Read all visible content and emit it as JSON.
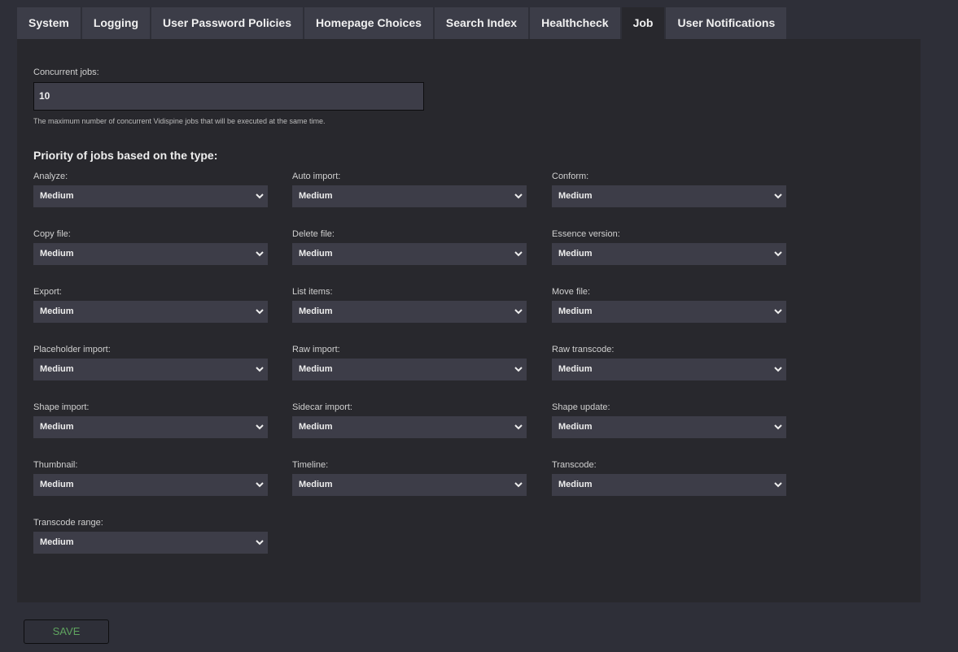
{
  "tabs": [
    "System",
    "Logging",
    "User Password Policies",
    "Homepage Choices",
    "Search Index",
    "Healthcheck",
    "Job",
    "User Notifications"
  ],
  "active_tab": "Job",
  "concurrent": {
    "label": "Concurrent jobs:",
    "value": "10",
    "help": "The maximum number of concurrent Vidispine jobs that will be executed at the same time."
  },
  "priority_heading": "Priority of jobs based on the type:",
  "fields": [
    {
      "label": "Analyze:",
      "value": "Medium"
    },
    {
      "label": "Auto import:",
      "value": "Medium"
    },
    {
      "label": "Conform:",
      "value": "Medium"
    },
    {
      "label": "Copy file:",
      "value": "Medium"
    },
    {
      "label": "Delete file:",
      "value": "Medium"
    },
    {
      "label": "Essence version:",
      "value": "Medium"
    },
    {
      "label": "Export:",
      "value": "Medium"
    },
    {
      "label": "List items:",
      "value": "Medium"
    },
    {
      "label": "Move file:",
      "value": "Medium"
    },
    {
      "label": "Placeholder import:",
      "value": "Medium"
    },
    {
      "label": "Raw import:",
      "value": "Medium"
    },
    {
      "label": "Raw transcode:",
      "value": "Medium"
    },
    {
      "label": "Shape import:",
      "value": "Medium"
    },
    {
      "label": "Sidecar import:",
      "value": "Medium"
    },
    {
      "label": "Shape update:",
      "value": "Medium"
    },
    {
      "label": "Thumbnail:",
      "value": "Medium"
    },
    {
      "label": "Timeline:",
      "value": "Medium"
    },
    {
      "label": "Transcode:",
      "value": "Medium"
    },
    {
      "label": "Transcode range:",
      "value": "Medium"
    }
  ],
  "save_label": "SAVE"
}
